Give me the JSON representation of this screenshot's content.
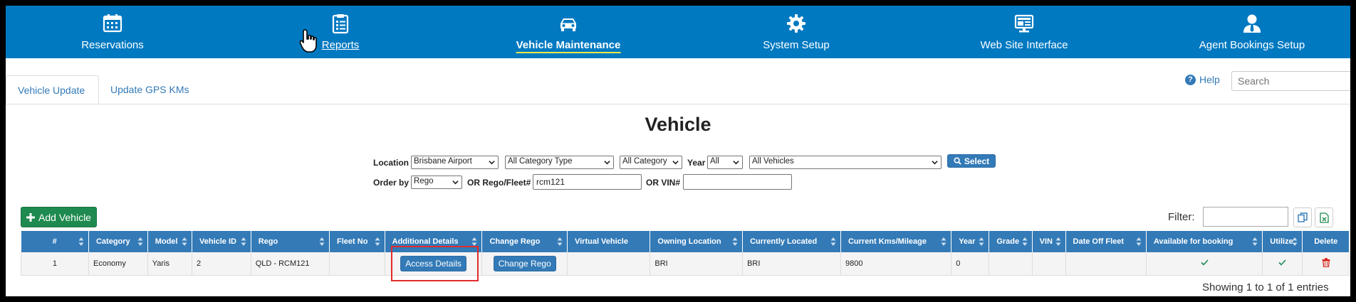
{
  "nav": {
    "items": [
      {
        "label": "Reservations"
      },
      {
        "label": "Reports"
      },
      {
        "label": "Vehicle Maintenance"
      },
      {
        "label": "System Setup"
      },
      {
        "label": "Web Site Interface"
      },
      {
        "label": "Agent Bookings Setup"
      }
    ],
    "active": "Vehicle Maintenance",
    "color": "#0079c1",
    "active_underline": "#f2e84a"
  },
  "tabs": [
    {
      "label": "Vehicle Update"
    },
    {
      "label": "Update GPS KMs"
    }
  ],
  "help": {
    "label": "Help",
    "glyph": "?"
  },
  "search": {
    "placeholder": "Search"
  },
  "page": {
    "title": "Vehicle"
  },
  "filters": {
    "location_label": "Location",
    "location_value": "Brisbane Airport",
    "category_type_value": "All Category Type",
    "category_value": "All Category",
    "year_label": "Year",
    "year_value": "All",
    "vehicles_value": "All Vehicles",
    "select_button": "Select",
    "order_by_label": "Order by",
    "order_by_value": "Rego",
    "rego_fleet_label": "OR Rego/Fleet#",
    "rego_fleet_value": "rcm121",
    "vin_label": "OR VIN#",
    "vin_value": ""
  },
  "toolbar": {
    "add_vehicle": "Add Vehicle",
    "filter_label": "Filter:"
  },
  "table": {
    "headers": [
      "#",
      "Category",
      "Model",
      "Vehicle ID",
      "Rego",
      "Fleet No",
      "Additional Details",
      "Change Rego",
      "Virtual Vehicle",
      "Owning Location",
      "Currently Located",
      "Current Kms/Mileage",
      "Year",
      "Grade",
      "VIN",
      "Date Off Fleet",
      "Available for booking",
      "Utilize",
      "Delete"
    ],
    "rows": [
      {
        "num": "1",
        "category": "Economy",
        "model": "Yaris",
        "vehicle_id": "2",
        "rego": "QLD - RCM121",
        "fleet_no": "",
        "additional_details": "Access Details",
        "change_rego": "Change Rego",
        "virtual_vehicle": "",
        "owning_location": "BRI",
        "currently_located": "BRI",
        "kms": "9800",
        "year": "0",
        "grade": "",
        "vin": "",
        "date_off_fleet": "",
        "available_icon": "check-icon",
        "utilize_icon": "check-icon",
        "delete_icon": "trash-icon"
      }
    ],
    "header_color": "#337ab7",
    "rego_color": "#d9221a"
  },
  "footer": {
    "showing": "Showing 1 to 1 of 1 entries"
  }
}
